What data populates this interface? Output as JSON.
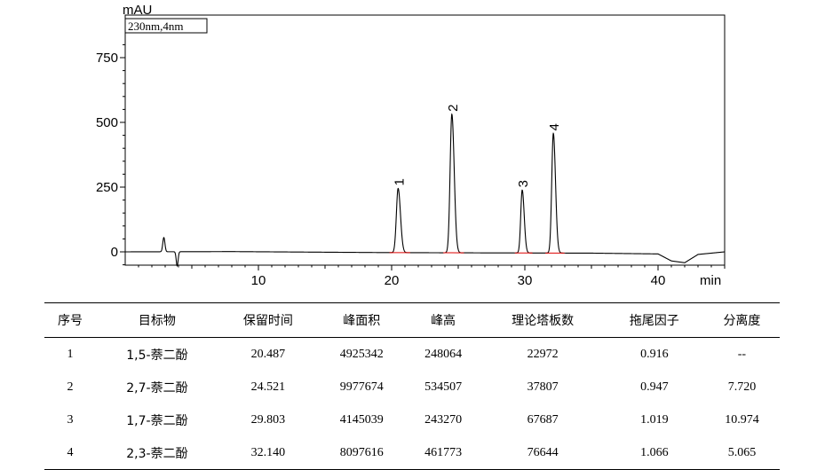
{
  "chart_data": {
    "type": "line",
    "y_unit": "mAU",
    "x_unit": "min",
    "wavelength_box": "230nm,4nm",
    "xlim": [
      0,
      45
    ],
    "ylim": [
      -100,
      850
    ],
    "x_ticks": [
      10,
      20,
      30,
      40
    ],
    "y_ticks": [
      0,
      250,
      500,
      750
    ],
    "baseline": {
      "x": [
        0,
        8,
        20,
        35,
        40,
        41,
        42,
        43,
        45
      ],
      "y": [
        0,
        1,
        -3,
        -5,
        -8,
        -35,
        -42,
        -10,
        0
      ]
    },
    "artifacts": [
      {
        "x": 2.9,
        "y": 55,
        "width": 0.08
      },
      {
        "x": 3.9,
        "y": -55,
        "width": 0.07
      }
    ],
    "peaks": [
      {
        "label": "1",
        "rt": 20.487,
        "height_mau": 248,
        "width": 0.13
      },
      {
        "label": "2",
        "rt": 24.521,
        "height_mau": 535,
        "width": 0.13
      },
      {
        "label": "3",
        "rt": 29.803,
        "height_mau": 243,
        "width": 0.11
      },
      {
        "label": "4",
        "rt": 32.14,
        "height_mau": 462,
        "width": 0.12
      }
    ]
  },
  "table": {
    "headers": [
      "序号",
      "目标物",
      "保留时间",
      "峰面积",
      "峰高",
      "理论塔板数",
      "拖尾因子",
      "分离度"
    ],
    "rows": [
      [
        "1",
        "1,5-萘二酚",
        "20.487",
        "4925342",
        "248064",
        "22972",
        "0.916",
        "--"
      ],
      [
        "2",
        "2,7-萘二酚",
        "24.521",
        "9977674",
        "534507",
        "37807",
        "0.947",
        "7.720"
      ],
      [
        "3",
        "1,7-萘二酚",
        "29.803",
        "4145039",
        "243270",
        "67687",
        "1.019",
        "10.974"
      ],
      [
        "4",
        "2,3-萘二酚",
        "32.140",
        "8097616",
        "461773",
        "76644",
        "1.066",
        "5.065"
      ]
    ]
  }
}
